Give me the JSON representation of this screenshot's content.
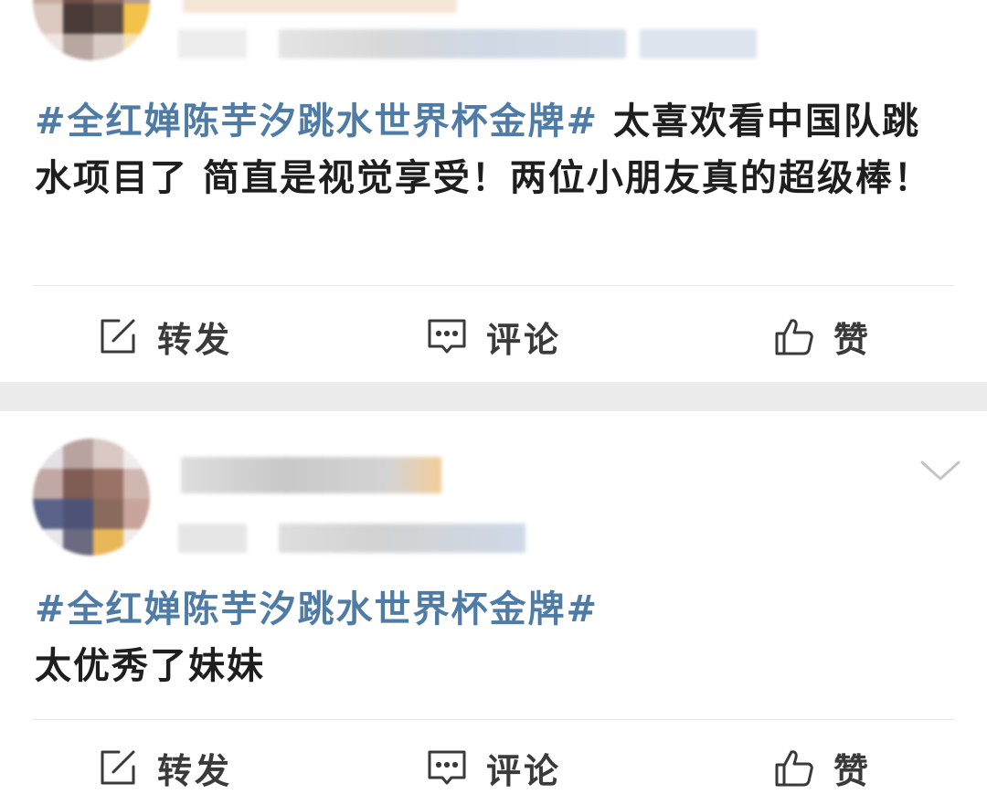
{
  "colors": {
    "hashtag": "#4e7ca6",
    "text": "#1e1e1e",
    "separator": "#ececec"
  },
  "posts": [
    {
      "hashtag": "#全红婵陈芋汐跳水世界杯金牌#",
      "text": "太喜欢看中国队跳水项目了 简直是视觉享受！两位小朋友真的超级棒！",
      "actions": {
        "repost": "转发",
        "comment": "评论",
        "like": "赞"
      }
    },
    {
      "hashtag": "#全红婵陈芋汐跳水世界杯金牌#",
      "text": "太优秀了妹妹",
      "actions": {
        "repost": "转发",
        "comment": "评论",
        "like": "赞"
      }
    }
  ],
  "icons": {
    "repost": "edit-square-icon",
    "comment": "comment-bubble-icon",
    "like": "thumbs-up-icon",
    "more": "chevron-down-icon"
  }
}
